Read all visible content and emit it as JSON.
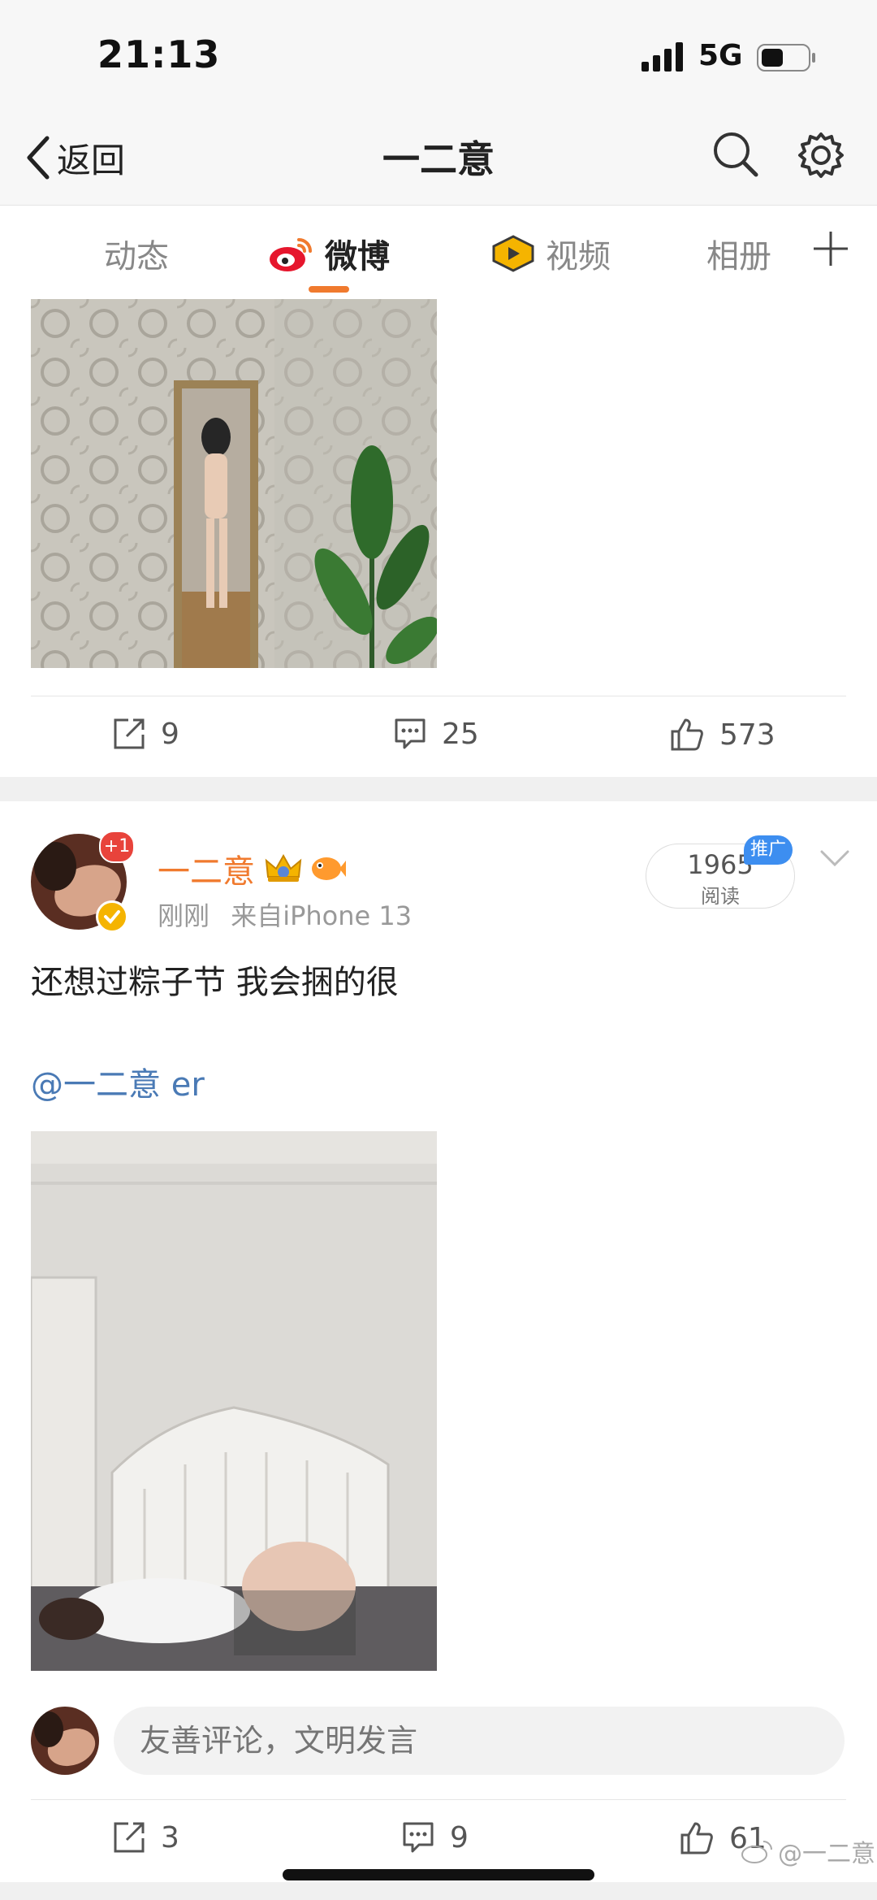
{
  "status": {
    "time": "21:13",
    "network": "5G"
  },
  "nav": {
    "back_label": "返回",
    "title": "一二意"
  },
  "tabs": [
    {
      "label": "动态"
    },
    {
      "label": "微博"
    },
    {
      "label": "视频"
    },
    {
      "label": "相册"
    }
  ],
  "post1": {
    "repost_count": "9",
    "comment_count": "25",
    "like_count": "573"
  },
  "post2": {
    "avatar_badge": "+1",
    "author": "一二意",
    "time": "刚刚",
    "source": "来自iPhone 13",
    "read_count": "1965",
    "read_label": "阅读",
    "promo_tag": "推广",
    "text": "还想过粽子节 我会捆的很",
    "mention": "@一二意 er",
    "comment_placeholder": "友善评论，文明发言",
    "repost_count": "3",
    "comment_count": "9",
    "like_count": "61"
  },
  "watermark": "@一二意",
  "colors": {
    "accent": "#f07a2e",
    "link": "#4a7ab5",
    "promo": "#3d8ef0",
    "badge_red": "#e8433b"
  }
}
